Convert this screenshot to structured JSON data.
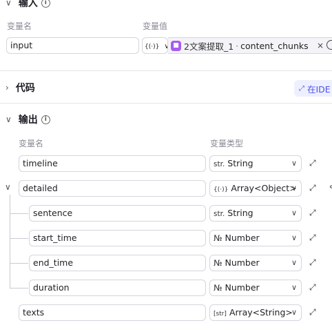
{
  "input_section": {
    "title": "输入",
    "col_name": "变量名",
    "col_value": "变量值",
    "var_name": "input",
    "ref_type_icon": "{(·)}",
    "ref_node": "2文案提取_1",
    "ref_separator": "·",
    "ref_field": "content_chunks",
    "clear_icon": "×"
  },
  "code_section": {
    "title": "代码",
    "ide_button": "在IDE"
  },
  "output_section": {
    "title": "输出",
    "col_name": "变量名",
    "col_type": "变量类型",
    "rows": [
      {
        "name": "timeline",
        "type_icon": "str.",
        "type": "String"
      },
      {
        "name": "detailed",
        "type_icon": "{(·)}",
        "type": "Array<Object>"
      },
      {
        "name": "sentence",
        "type_icon": "str.",
        "type": "String"
      },
      {
        "name": "start_time",
        "type_icon": "№",
        "type": "Number"
      },
      {
        "name": "end_time",
        "type_icon": "№",
        "type": "Number"
      },
      {
        "name": "duration",
        "type_icon": "№",
        "type": "Number"
      },
      {
        "name": "texts",
        "type_icon": "[str]",
        "type": "Array<String>"
      }
    ]
  },
  "colors": {
    "accent": "#4d53e8",
    "ide_bg": "#eef0ff",
    "node_icon": "#a55df2"
  }
}
